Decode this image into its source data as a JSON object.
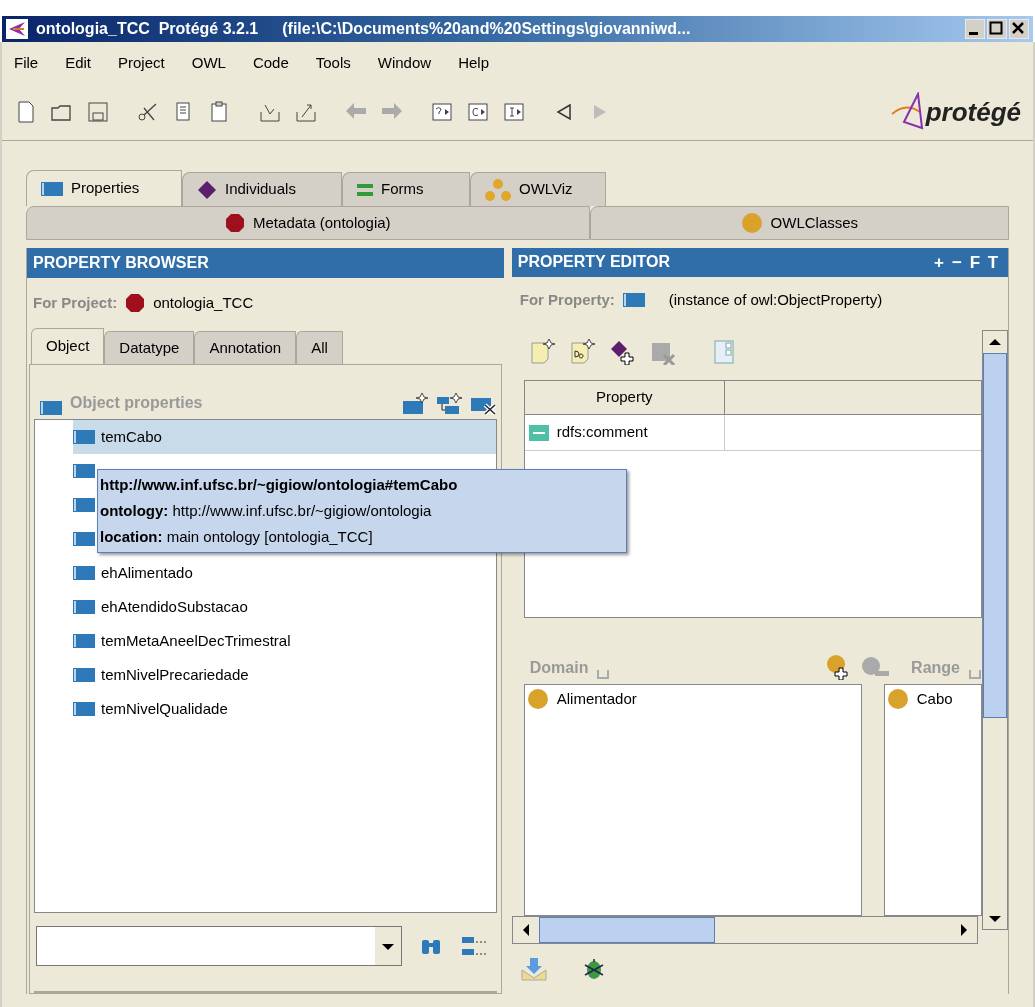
{
  "window": {
    "title": "ontologia_TCC  Protégé 3.2.1",
    "path": "(file:\\C:\\Documents%20and%20Settings\\giovanniwd..."
  },
  "menu": [
    "File",
    "Edit",
    "Project",
    "OWL",
    "Code",
    "Tools",
    "Window",
    "Help"
  ],
  "logo": "protégé",
  "tabs": [
    {
      "label": "Properties",
      "kind": "property",
      "selected": true
    },
    {
      "label": "Individuals",
      "kind": "individual",
      "selected": false
    },
    {
      "label": "Forms",
      "kind": "form",
      "selected": false
    },
    {
      "label": "OWLViz",
      "kind": "viz",
      "selected": false
    }
  ],
  "tabs_row2": [
    {
      "label": "Metadata (ontologia)",
      "kind": "metadata",
      "selected": false
    },
    {
      "label": "OWLClasses",
      "kind": "class",
      "selected": false
    }
  ],
  "browser": {
    "title": "PROPERTY BROWSER",
    "project_label": "For Project:",
    "project": "ontologia_TCC",
    "subtabs": [
      {
        "label": "Object",
        "selected": true
      },
      {
        "label": "Datatype",
        "selected": false
      },
      {
        "label": "Annotation",
        "selected": false
      },
      {
        "label": "All",
        "selected": false
      }
    ],
    "tree_title": "Object properties",
    "items": [
      {
        "label": "temCabo",
        "kind": "text",
        "selected": true
      },
      {
        "kind": "covered",
        "selected": false
      },
      {
        "kind": "covered",
        "selected": false
      },
      {
        "kind": "covered",
        "selected": false
      },
      {
        "label": "ehAlimentado",
        "kind": "text",
        "selected": false
      },
      {
        "label": "ehAtendidoSubstacao",
        "kind": "text",
        "selected": false
      },
      {
        "label": "temMetaAneelDecTrimestral",
        "kind": "text",
        "selected": false
      },
      {
        "label": "temNivelPrecariedade",
        "kind": "text",
        "selected": false
      },
      {
        "label": "temNivelQualidade",
        "kind": "text",
        "selected": false
      }
    ],
    "tooltip": [
      {
        "text": "http://www.inf.ufsc.br/~gigiow/ontologia#temCabo",
        "kind": "uri"
      },
      {
        "text": "**ontology:** http://www.inf.ufsc.br/~gigiow/ontologia",
        "kind": "line"
      },
      {
        "text": "**location:** main ontology [ontologia_TCC]",
        "kind": "line"
      }
    ]
  },
  "editor": {
    "title": "PROPERTY EDITOR",
    "header_buttons": [
      "+",
      "−",
      "F",
      "T"
    ],
    "for_label": "For Property:",
    "instance": "(instance of owl:ObjectProperty)",
    "columns": [
      "Property"
    ],
    "rows": [
      {
        "property": "rdfs:comment"
      }
    ],
    "domain_label": "Domain",
    "domain": [
      "Alimentador"
    ],
    "range_label": "Range",
    "range": [
      "Cabo"
    ]
  }
}
